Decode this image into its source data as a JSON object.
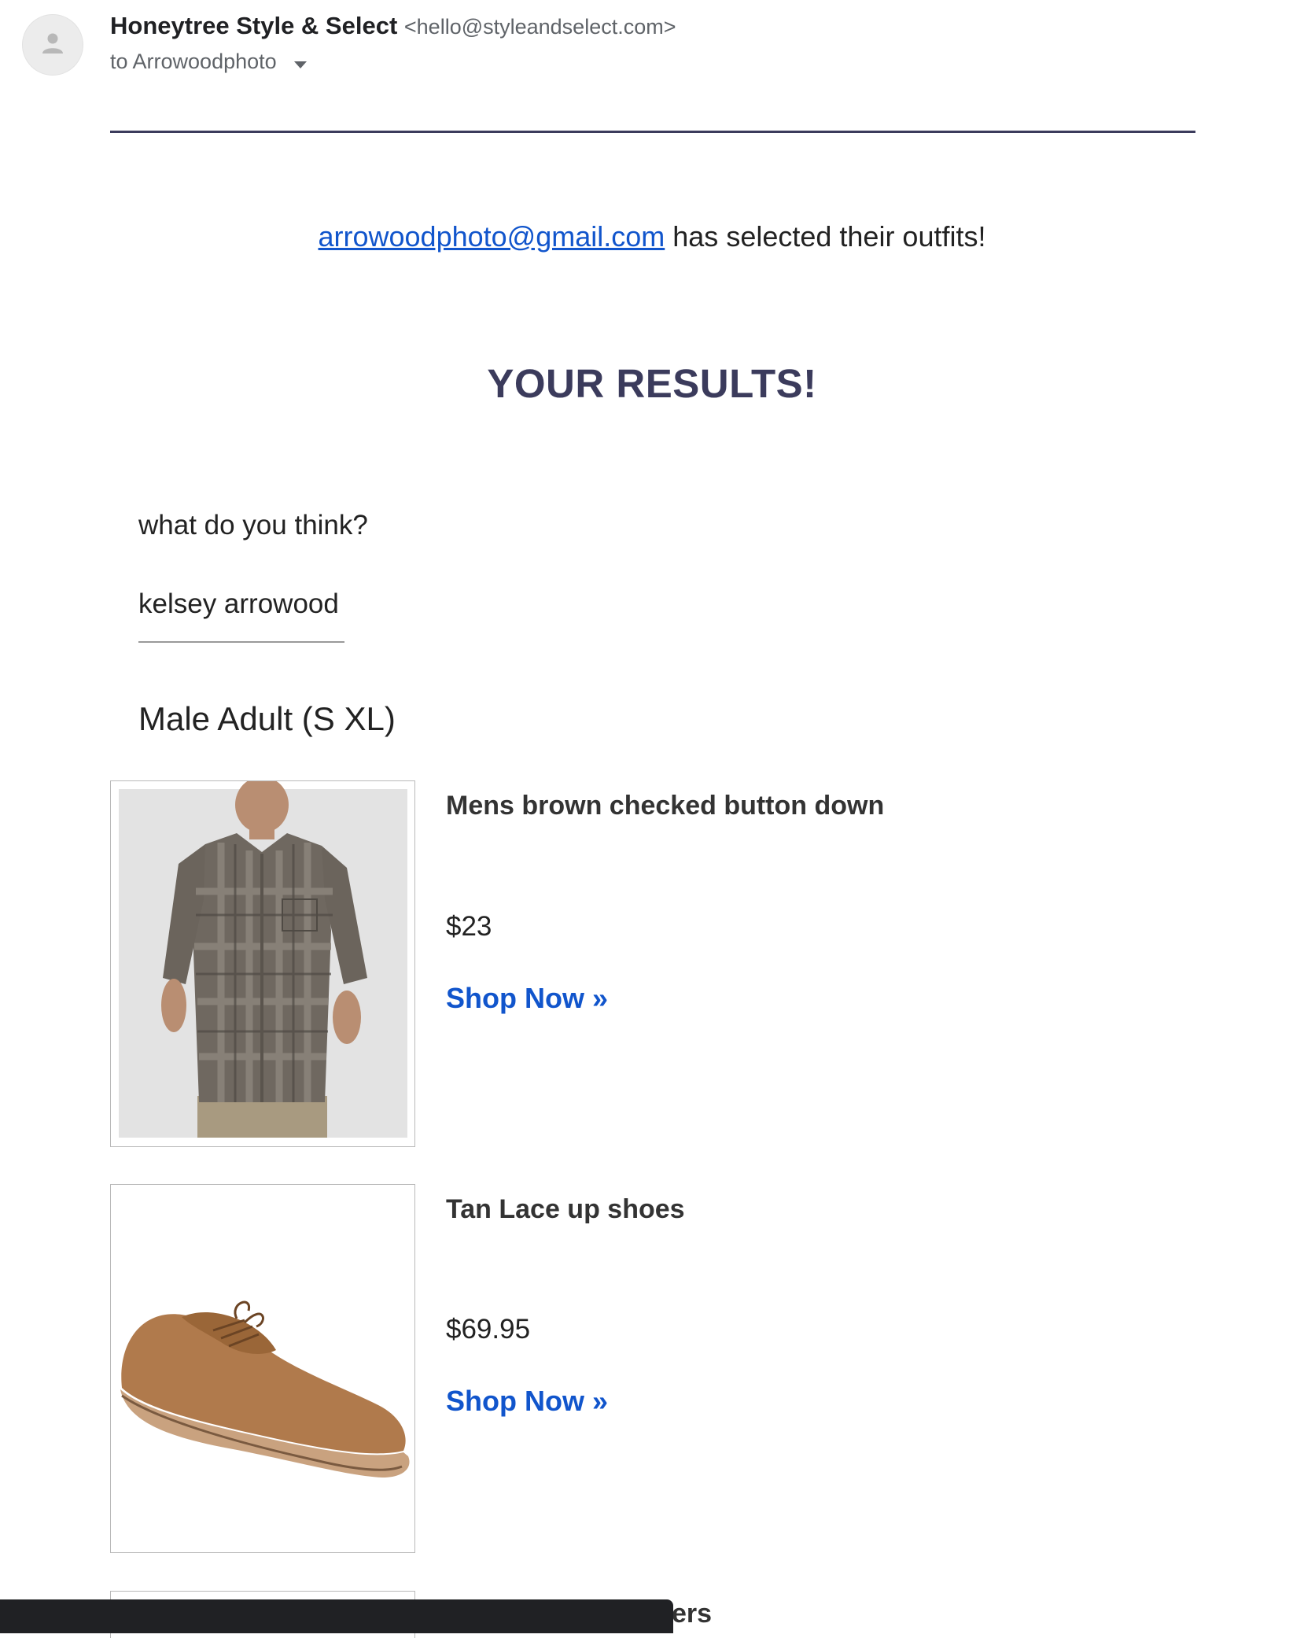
{
  "header": {
    "avatar_icon": "person-icon",
    "sender_name": "Honeytree Style & Select",
    "sender_email": "<hello@styleandselect.com>",
    "recipients": "to Arrowoodphoto"
  },
  "body": {
    "selected_email": "arrowoodphoto@gmail.com",
    "selected_text": " has selected their outfits!",
    "results_title": "YOUR RESULTS!",
    "question": "what do you think?",
    "answer": "kelsey arrowood",
    "group_title": "Male Adult (S XL)",
    "products": [
      {
        "name": "Mens brown checked button down",
        "price": "$23",
        "link": "Shop Now »"
      },
      {
        "name": "Tan Lace up shoes",
        "price": "$69.95",
        "link": "Shop Now »"
      }
    ],
    "partial_text": "ers"
  },
  "colors": {
    "accent": "#3b3b5c",
    "link": "#1155cc"
  }
}
